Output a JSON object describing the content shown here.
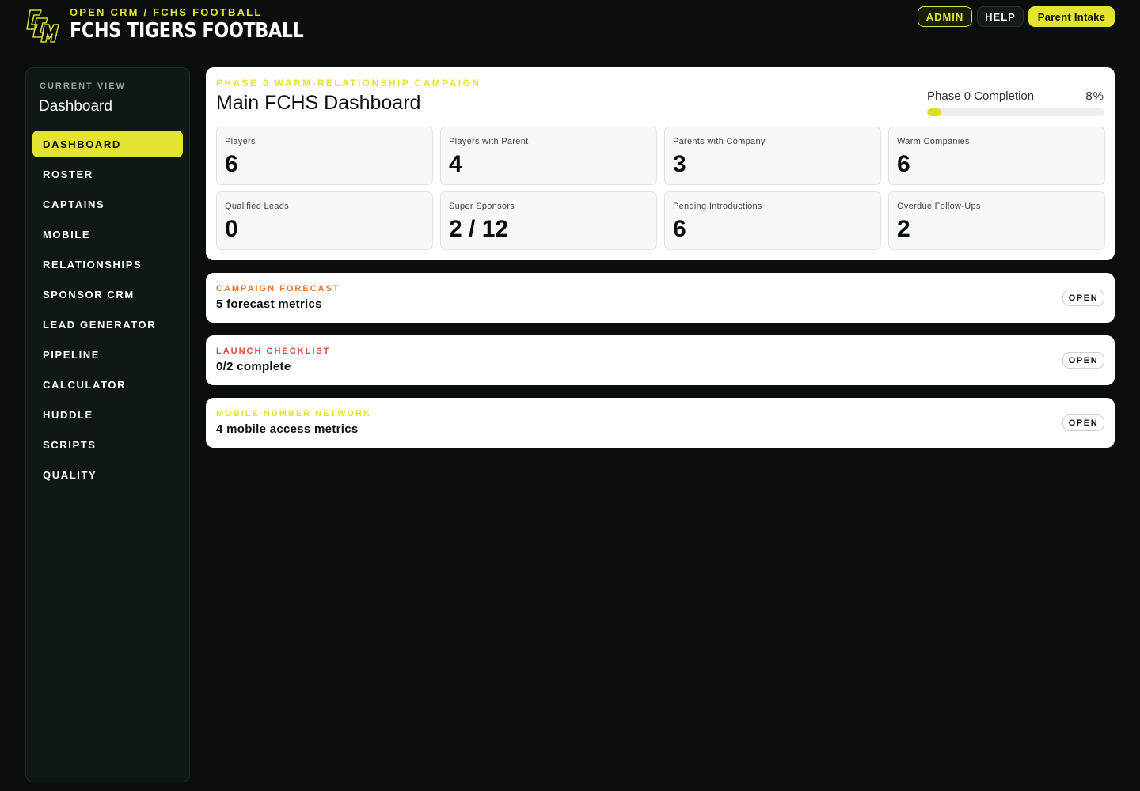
{
  "header": {
    "subtitle": "OPEN CRM / FCHS FOOTBALL",
    "title": "FCHS TIGERS FOOTBALL",
    "logo_icon": "ocm-monogram-logo",
    "actions": {
      "admin": "ADMIN",
      "help": "HELP",
      "parent_intake": "Parent Intake"
    }
  },
  "sidebar": {
    "current_view_label": "CURRENT VIEW",
    "current_view": "Dashboard",
    "items": [
      {
        "label": "DASHBOARD",
        "active": true
      },
      {
        "label": "ROSTER"
      },
      {
        "label": "CAPTAINS"
      },
      {
        "label": "MOBILE"
      },
      {
        "label": "RELATIONSHIPS"
      },
      {
        "label": "SPONSOR CRM"
      },
      {
        "label": "LEAD GENERATOR"
      },
      {
        "label": "PIPELINE"
      },
      {
        "label": "CALCULATOR"
      },
      {
        "label": "HUDDLE"
      },
      {
        "label": "SCRIPTS"
      },
      {
        "label": "QUALITY"
      }
    ]
  },
  "dashboard": {
    "kicker": "PHASE 0 WARM-RELATIONSHIP CAMPAIGN",
    "title": "Main FCHS Dashboard",
    "progress": {
      "label": "Phase 0 Completion",
      "percent_text": "8%",
      "value": 0.08
    },
    "stats": [
      {
        "label": "Players",
        "value": "6"
      },
      {
        "label": "Players with Parent",
        "value": "4"
      },
      {
        "label": "Parents with Company",
        "value": "3"
      },
      {
        "label": "Warm Companies",
        "value": "6"
      },
      {
        "label": "Qualified Leads",
        "value": "0"
      },
      {
        "label": "Super Sponsors",
        "value": "2 / 12"
      },
      {
        "label": "Pending Introductions",
        "value": "6"
      },
      {
        "label": "Overdue Follow-Ups",
        "value": "2"
      }
    ]
  },
  "cards": [
    {
      "kicker": "CAMPAIGN FORECAST",
      "text": "5 forecast metrics",
      "button": "OPEN",
      "color": "#e8792c"
    },
    {
      "kicker": "LAUNCH CHECKLIST",
      "text": "0/2 complete",
      "button": "OPEN",
      "color": "#e04a3a"
    },
    {
      "kicker": "MOBILE NUMBER NETWORK",
      "text": "4 mobile access metrics",
      "button": "OPEN",
      "color": "#e3e332"
    }
  ],
  "colors": {
    "accent": "#e3e332",
    "background": "#0a0f0e",
    "sidebar": "#101816"
  }
}
